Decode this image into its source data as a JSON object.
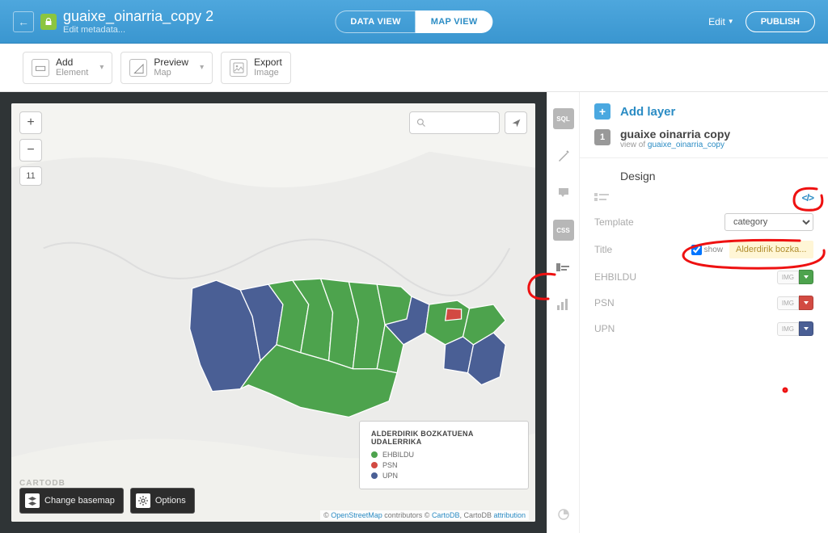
{
  "header": {
    "title": "guaixe_oinarria_copy 2",
    "edit_metadata": "Edit metadata...",
    "data_view": "DATA VIEW",
    "map_view": "MAP VIEW",
    "edit": "Edit",
    "publish": "PUBLISH"
  },
  "toolbar": {
    "add": {
      "t1": "Add",
      "t2": "Element"
    },
    "preview": {
      "t1": "Preview",
      "t2": "Map"
    },
    "export": {
      "t1": "Export",
      "t2": "Image"
    }
  },
  "map": {
    "zoom_level": "11",
    "search_placeholder": "",
    "legend": {
      "title": "ALDERDIRIK BOZKATUENA UDALERRIKA",
      "items": [
        {
          "label": "EHBILDU",
          "color": "#4da34d"
        },
        {
          "label": "PSN",
          "color": "#d24a42"
        },
        {
          "label": "UPN",
          "color": "#4a5f95"
        }
      ]
    },
    "change_basemap": "Change basemap",
    "options": "Options",
    "logo": "CARTODB",
    "attrib_prefix": "© ",
    "attrib_osm": "OpenStreetMap",
    "attrib_mid": " contributors © ",
    "attrib_cdb": "CartoDB",
    "attrib_sep": ", CartoDB ",
    "attrib_link": "attribution"
  },
  "rail": {
    "sql": "SQL",
    "css": "CSS"
  },
  "panel": {
    "add_layer": "Add layer",
    "layer_num": "1",
    "layer_name": "guaixe oinarria copy",
    "layer_sub_prefix": "view of ",
    "layer_sub_link": "guaixe_oinarria_copy",
    "design": "Design",
    "code_icon": "</>",
    "template_label": "Template",
    "template_value": "category",
    "title_label": "Title",
    "show_label": "show",
    "title_value": "Alderdirik bozka...",
    "cats": [
      {
        "name": "EHBILDU",
        "color": "#4da34d"
      },
      {
        "name": "PSN",
        "color": "#d24a42"
      },
      {
        "name": "UPN",
        "color": "#4a5f95"
      }
    ],
    "img": "IMG"
  },
  "colors": {
    "green": "#4da34d",
    "red": "#d24a42",
    "navy": "#4a5f95"
  }
}
